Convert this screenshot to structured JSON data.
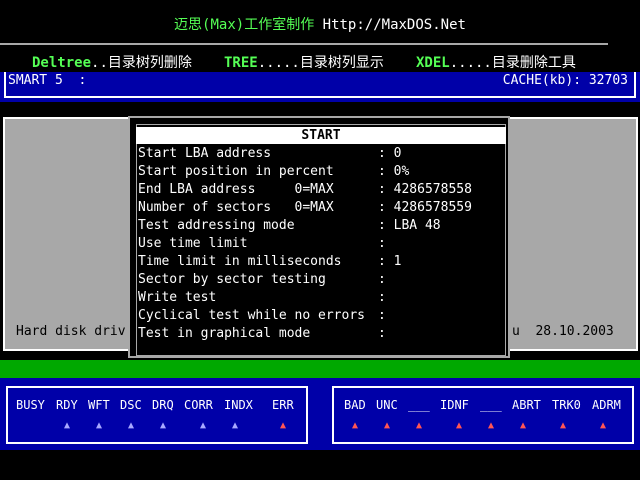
{
  "banner": {
    "cn_title": "迈思(Max)工作室制作",
    "url": "Http://MaxDOS.Net"
  },
  "commands": [
    {
      "key": "Deltree",
      "desc": "..目录树列删除"
    },
    {
      "key": "TREE",
      "desc": ".....目录树列显示"
    },
    {
      "key": "XDEL",
      "desc": ".....目录删除工具"
    }
  ],
  "top_bar": {
    "smart": "SMART 5  :",
    "cache": "CACHE(kb): 32703"
  },
  "hd_info": {
    "left": "Hard disk driv",
    "right": "u  28.10.2003"
  },
  "dialog": {
    "title": "START",
    "rows": [
      {
        "label": "Start LBA address",
        "value": ": 0"
      },
      {
        "label": "Start position in percent",
        "value": ": 0%"
      },
      {
        "label": "End LBA address     0=MAX",
        "value": ": 4286578558"
      },
      {
        "label": "Number of sectors   0=MAX",
        "value": ": 4286578559"
      },
      {
        "label": "Test addressing mode",
        "value": ": LBA 48"
      },
      {
        "label": "Use time limit",
        "value": ":"
      },
      {
        "label": "Time limit in milliseconds",
        "value": ": 1"
      },
      {
        "label": "Sector by sector testing",
        "value": ":"
      },
      {
        "label": "Write test",
        "value": ":"
      },
      {
        "label": "Cyclical test while no errors",
        "value": ":"
      },
      {
        "label": "Test in graphical mode",
        "value": ":"
      }
    ]
  },
  "status_regs": [
    "BUSY",
    "RDY",
    "WFT",
    "DSC",
    "DRQ",
    "CORR",
    "INDX",
    "ERR"
  ],
  "error_regs": [
    "BAD",
    "UNC",
    "___",
    "IDNF",
    "___",
    "ABRT",
    "TRK0",
    "ADRM"
  ],
  "status_indicator_colors": [
    "#a8a8ff",
    "#a8a8ff",
    "#a8a8ff",
    "#a8a8ff",
    "#a8a8ff",
    "#a8a8ff",
    "#a8a8ff",
    "#ff5555"
  ],
  "error_indicator_color": "#ff5555",
  "colors": {
    "banner": "#55ff55",
    "panel_blue": "#0000a8",
    "grey": "#a8a8a8",
    "green": "#00a800"
  }
}
